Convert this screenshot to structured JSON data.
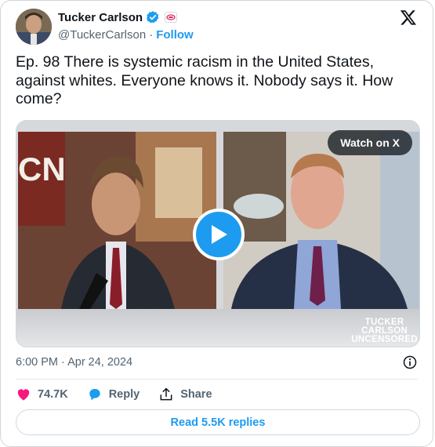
{
  "author": {
    "name": "Tucker Carlson",
    "handle": "@TuckerCarlson",
    "separator": "·",
    "follow_label": "Follow"
  },
  "tweet": {
    "text": "Ep. 98  There is systemic racism in the United States, against whites. Everyone knows it. Nobody says it. How come?",
    "timestamp": "6:00 PM · Apr 24, 2024"
  },
  "media": {
    "watch_label": "Watch on X",
    "brand_lines": [
      "TUCKER",
      "CARLSON",
      "UNCENSORED"
    ],
    "backdrop_text": "CN"
  },
  "actions": {
    "likes_count": "74.7K",
    "reply_label": "Reply",
    "share_label": "Share"
  },
  "read_replies_label": "Read 5.5K replies",
  "colors": {
    "accent": "#1d9bf0",
    "like": "#f91880",
    "text": "#0f1419",
    "muted": "#536471"
  }
}
